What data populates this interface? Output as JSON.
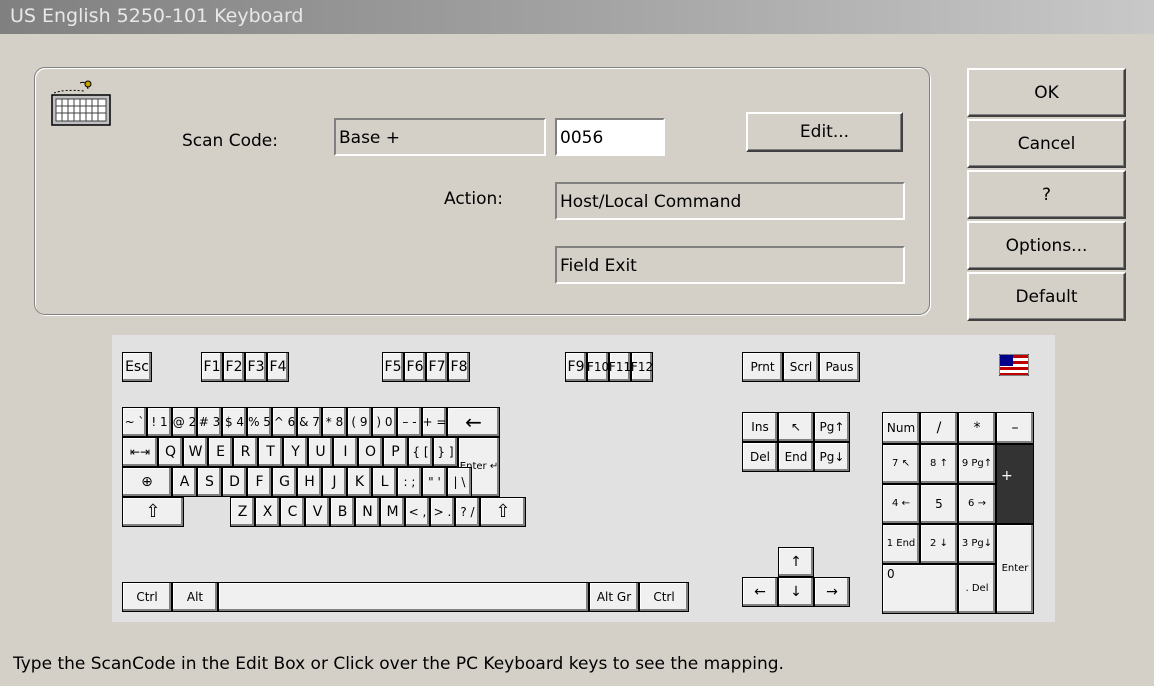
{
  "window": {
    "title": "US English 5250-101 Keyboard"
  },
  "mapping": {
    "scan_code_label": "Scan Code:",
    "base_value": "Base +",
    "code_value": "0056",
    "edit_label": "Edit...",
    "action_label": "Action:",
    "action_value": "Host/Local Command",
    "action_detail": "Field Exit"
  },
  "buttons": {
    "ok": "OK",
    "cancel": "Cancel",
    "help": "?",
    "options": "Options...",
    "default": "Default"
  },
  "keyboard": {
    "esc": "Esc",
    "f1": "F1",
    "f2": "F2",
    "f3": "F3",
    "f4": "F4",
    "f5": "F5",
    "f6": "F6",
    "f7": "F7",
    "f8": "F8",
    "f9": "F9",
    "f10": "F10",
    "f11": "F11",
    "f12": "F12",
    "prnt": "Prnt",
    "scrl": "Scrl",
    "paus": "Paus",
    "backquote": "~ `",
    "k1": "! 1",
    "k2": "@ 2",
    "k3": "# 3",
    "k4": "$ 4",
    "k5": "% 5",
    "k6": "^ 6",
    "k7": "& 7",
    "k8": "* 8",
    "k9": "( 9",
    "k0": ") 0",
    "minus": "– -",
    "equals": "+ =",
    "backspace": "←",
    "tab": "⇤⇥",
    "q": "Q",
    "w": "W",
    "e": "E",
    "r": "R",
    "t": "T",
    "y": "Y",
    "u": "U",
    "i": "I",
    "o": "O",
    "p": "P",
    "lbracket": "{ [",
    "rbracket": "} ]",
    "enter": "Enter ↵",
    "caps": "⊕",
    "a": "A",
    "s": "S",
    "d": "D",
    "f": "F",
    "g": "G",
    "h": "H",
    "j": "J",
    "k": "K",
    "l": "L",
    "semicolon": ": ;",
    "quote": "\" '",
    "backslash": "| \\",
    "lshift": "⇧",
    "z": "Z",
    "x": "X",
    "c": "C",
    "v": "V",
    "b": "B",
    "n": "N",
    "m": "M",
    "comma": "< ,",
    "period": "> .",
    "slash": "? /",
    "rshift": "⇧",
    "lctrl": "Ctrl",
    "alt": "Alt",
    "altgr": "Alt Gr",
    "rctrl": "Ctrl",
    "ins": "Ins",
    "home": "↖",
    "pgup": "Pg↑",
    "del": "Del",
    "end": "End",
    "pgdn": "Pg↓",
    "up": "↑",
    "left": "←",
    "down": "↓",
    "right": "→",
    "numlock": "Num",
    "npdiv": "/",
    "npmul": "*",
    "npsub": "–",
    "np7": "7 ↖",
    "np8": "8 ↑",
    "np9": "9 Pg↑",
    "npadd": "+",
    "np4": "4 ←",
    "np5": "5",
    "np6": "6 →",
    "np1": "1 End",
    "np2": "2 ↓",
    "np3": "3 Pg↓",
    "npenter": "Enter",
    "np0": "0",
    "npdot": ". Del"
  },
  "status_text": "Type the ScanCode in the Edit Box or Click over the PC Keyboard keys to see the mapping.",
  "colors": {
    "face": "#d4d0c8",
    "title_start": "#808080",
    "key_selected": "#333333"
  },
  "icons": {
    "keyboard": "keyboard-icon",
    "flag": "us-flag-icon"
  }
}
